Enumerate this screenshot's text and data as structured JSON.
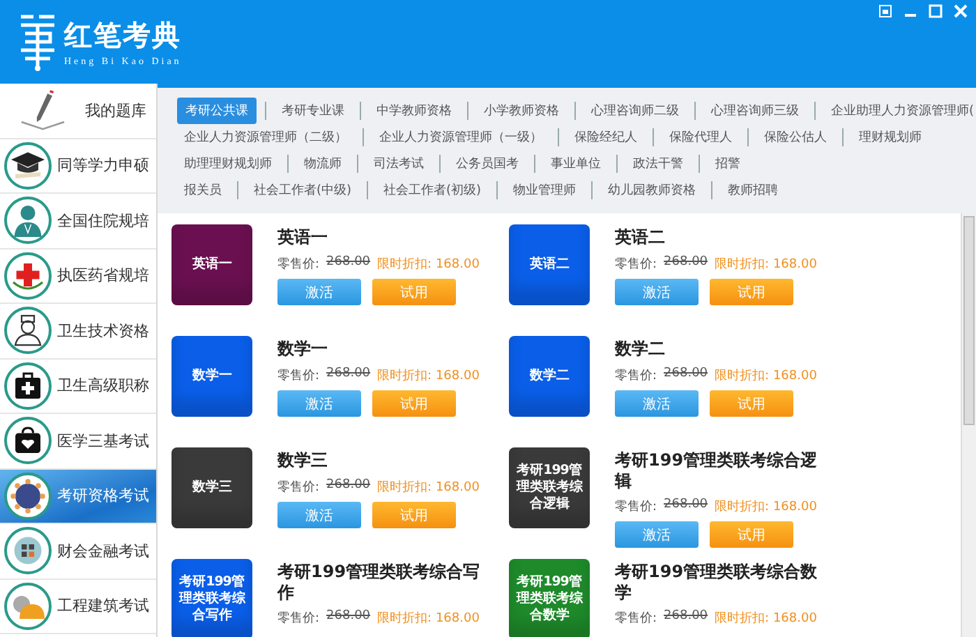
{
  "header": {
    "title": "红笔考典",
    "subtitle": "Heng Bi Kao Dian"
  },
  "sidebar": {
    "items": [
      {
        "label": "我的题库",
        "kind": "pen",
        "selected": false
      },
      {
        "label": "同等学力申硕",
        "kind": "cap",
        "selected": false
      },
      {
        "label": "全国住院规培",
        "kind": "doctor",
        "selected": false
      },
      {
        "label": "执医药省规培",
        "kind": "cross",
        "selected": false
      },
      {
        "label": "卫生技术资格",
        "kind": "nurse",
        "selected": false
      },
      {
        "label": "卫生高级职称",
        "kind": "kit",
        "selected": false
      },
      {
        "label": "医学三基考试",
        "kind": "bag",
        "selected": false
      },
      {
        "label": "考研资格考试",
        "kind": "gear",
        "selected": true
      },
      {
        "label": "财会金融考试",
        "kind": "calc",
        "selected": false
      },
      {
        "label": "工程建筑考试",
        "kind": "helmet",
        "selected": false
      }
    ]
  },
  "tab_rows": [
    [
      {
        "label": "考研公共课",
        "selected": true
      },
      {
        "label": "考研专业课",
        "selected": false
      },
      {
        "label": "中学教师资格",
        "selected": false
      },
      {
        "label": "小学教师资格",
        "selected": false
      },
      {
        "label": "心理咨询师二级",
        "selected": false
      },
      {
        "label": "心理咨询师三级",
        "selected": false
      },
      {
        "label": "企业助理人力资源管理师(",
        "selected": false
      }
    ],
    [
      {
        "label": "企业人力资源管理师（二级）",
        "selected": false
      },
      {
        "label": "企业人力资源管理师（一级）",
        "selected": false
      },
      {
        "label": "保险经纪人",
        "selected": false
      },
      {
        "label": "保险代理人",
        "selected": false
      },
      {
        "label": "保险公估人",
        "selected": false
      },
      {
        "label": "理财规划师",
        "selected": false
      }
    ],
    [
      {
        "label": "助理理财规划师",
        "selected": false
      },
      {
        "label": "物流师",
        "selected": false
      },
      {
        "label": "司法考试",
        "selected": false
      },
      {
        "label": "公务员国考",
        "selected": false
      },
      {
        "label": "事业单位",
        "selected": false
      },
      {
        "label": "政法干警",
        "selected": false
      },
      {
        "label": "招警",
        "selected": false
      }
    ],
    [
      {
        "label": "报关员",
        "selected": false
      },
      {
        "label": "社会工作者(中级)",
        "selected": false
      },
      {
        "label": "社会工作者(初级)",
        "selected": false
      },
      {
        "label": "物业管理师",
        "selected": false
      },
      {
        "label": "幼儿园教师资格",
        "selected": false
      },
      {
        "label": "教师招聘",
        "selected": false
      }
    ]
  ],
  "products": [
    {
      "cover_text": "英语一",
      "color": "#6a1050",
      "title": "英语一",
      "price_label": "零售价:",
      "price": "268.00",
      "discount": "限时折扣: 168.00",
      "buttons": [
        "激活",
        "试用"
      ]
    },
    {
      "cover_text": "英语二",
      "color": "#0a5ee8",
      "title": "英语二",
      "price_label": "零售价:",
      "price": "268.00",
      "discount": "限时折扣: 168.00",
      "buttons": [
        "激活",
        "试用"
      ]
    },
    {
      "cover_text": "数学一",
      "color": "#0a5ee8",
      "title": "数学一",
      "price_label": "零售价:",
      "price": "268.00",
      "discount": "限时折扣: 168.00",
      "buttons": [
        "激活",
        "试用"
      ]
    },
    {
      "cover_text": "数学二",
      "color": "#0a5ee8",
      "title": "数学二",
      "price_label": "零售价:",
      "price": "268.00",
      "discount": "限时折扣: 168.00",
      "buttons": [
        "激活",
        "试用"
      ]
    },
    {
      "cover_text": "数学三",
      "color": "#3a3a3a",
      "title": "数学三",
      "price_label": "零售价:",
      "price": "268.00",
      "discount": "限时折扣: 168.00",
      "buttons": [
        "激活",
        "试用"
      ]
    },
    {
      "cover_text": "考研199管理类联考综合逻辑",
      "color": "#3a3a3a",
      "title": "考研199管理类联考综合逻辑",
      "price_label": "零售价:",
      "price": "268.00",
      "discount": "限时折扣: 168.00",
      "buttons": [
        "激活",
        "试用"
      ]
    },
    {
      "cover_text": "考研199管理类联考综合写作",
      "color": "#0a5ee8",
      "title": "考研199管理类联考综合写作",
      "price_label": "零售价:",
      "price": "268.00",
      "discount": "限时折扣: 168.00"
    },
    {
      "cover_text": "考研199管理类联考综合数学",
      "color": "#1e8a2a",
      "title": "考研199管理类联考综合数学",
      "price_label": "零售价:",
      "price": "268.00",
      "discount": "限时折扣: 168.00"
    }
  ]
}
